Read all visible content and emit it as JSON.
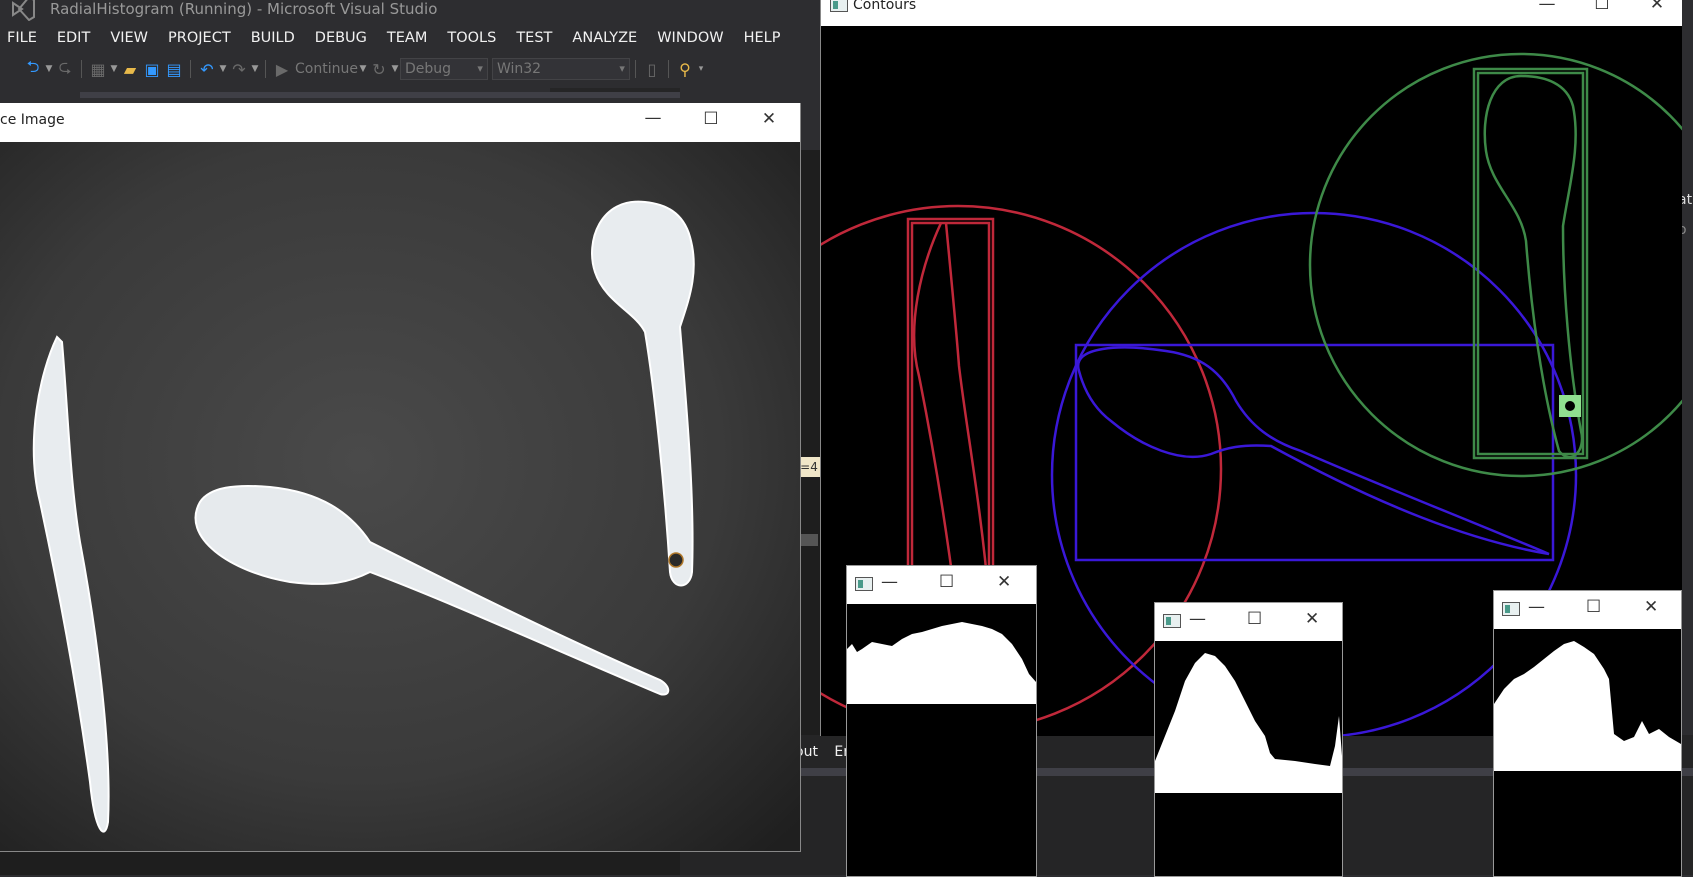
{
  "vs": {
    "title": "RadialHistogram (Running) - Microsoft Visual Studio",
    "menu": [
      "FILE",
      "EDIT",
      "VIEW",
      "PROJECT",
      "BUILD",
      "DEBUG",
      "TEAM",
      "TOOLS",
      "TEST",
      "ANALYZE",
      "WINDOW",
      "HELP"
    ],
    "toolbar": {
      "continue_label": "Continue",
      "config": "Debug",
      "platform": "Win32"
    },
    "bottom_tabs": [
      "out",
      "Err"
    ],
    "marker_text": "=4",
    "edge_text": "at",
    "edge_text2": "o"
  },
  "source_window": {
    "title": "ce Image"
  },
  "contours_window": {
    "title": "Contours"
  },
  "histograms": [
    {
      "id": "hist-1"
    },
    {
      "id": "hist-2"
    },
    {
      "id": "hist-3"
    }
  ],
  "colors": {
    "contour_red": "#c0283a",
    "contour_blue": "#3a18d8",
    "contour_green": "#3e8a48",
    "marker_green": "#90e090",
    "vs_accent": "#3399ff"
  },
  "window_controls": {
    "minimize": "—",
    "maximize": "☐",
    "close": "✕"
  }
}
